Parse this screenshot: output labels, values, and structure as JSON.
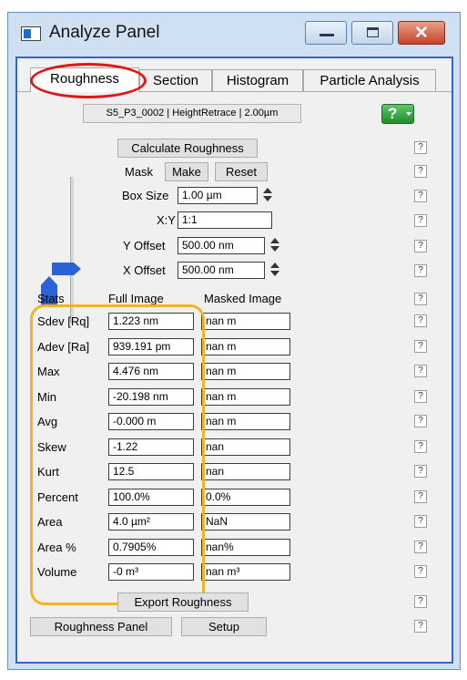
{
  "window": {
    "title": "Analyze Panel",
    "accent_color": "#2f63d6",
    "close_glyph": "✕"
  },
  "tabs": [
    {
      "label": "Roughness",
      "active": true
    },
    {
      "label": "Section",
      "active": false
    },
    {
      "label": "Histogram",
      "active": false
    },
    {
      "label": "Particle Analysis",
      "active": false
    }
  ],
  "image_info": "S5_P3_0002 | HeightRetrace | 2.00µm",
  "help_button_glyph": "?",
  "help_small_glyph": "?",
  "controls": {
    "calculate_label": "Calculate Roughness",
    "mask_label": "Mask",
    "make_label": "Make",
    "reset_label": "Reset",
    "box_size_label": "Box Size",
    "box_size_value": "1.00 µm",
    "xy_label": "X:Y",
    "xy_value": "1:1",
    "y_offset_label": "Y Offset",
    "y_offset_value": "500.00 nm",
    "x_offset_label": "X Offset",
    "x_offset_value": "500.00 nm"
  },
  "stats": {
    "headers": {
      "stat": "Stats",
      "full": "Full Image",
      "masked": "Masked Image"
    },
    "rows": [
      {
        "label": "Sdev [Rq]",
        "full": "1.223 nm",
        "masked": "nan m"
      },
      {
        "label": "Adev [Ra]",
        "full": "939.191 pm",
        "masked": "nan m"
      },
      {
        "label": "Max",
        "full": "4.476 nm",
        "masked": "nan m"
      },
      {
        "label": "Min",
        "full": "-20.198 nm",
        "masked": "nan m"
      },
      {
        "label": "Avg",
        "full": "-0.000 m",
        "masked": "nan m"
      },
      {
        "label": "Skew",
        "full": "-1.22",
        "masked": "nan"
      },
      {
        "label": "Kurt",
        "full": "12.5",
        "masked": "nan"
      },
      {
        "label": "Percent",
        "full": "100.0%",
        "masked": "0.0%"
      },
      {
        "label": "Area",
        "full": "4.0 µm²",
        "masked": "NaN"
      },
      {
        "label": "Area %",
        "full": "0.7905%",
        "masked": "nan%"
      },
      {
        "label": "Volume",
        "full": "-0 m³",
        "masked": "nan m³"
      }
    ]
  },
  "footer": {
    "export_label": "Export Roughness",
    "panel_label": "Roughness Panel",
    "setup_label": "Setup"
  },
  "annotation_colors": {
    "oval": "#e01515",
    "box": "#f0b429"
  }
}
